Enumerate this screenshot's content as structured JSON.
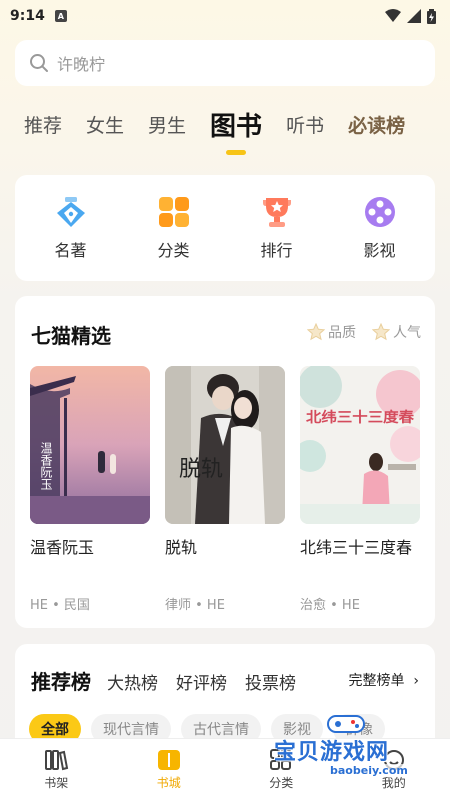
{
  "status": {
    "time": "9:14",
    "notif": "A"
  },
  "search": {
    "placeholder": "许晚柠"
  },
  "tabs": [
    "推荐",
    "女生",
    "男生",
    "图书",
    "听书",
    "必读榜"
  ],
  "shortcuts": [
    {
      "label": "名著",
      "icon": "pen-nib-icon"
    },
    {
      "label": "分类",
      "icon": "grid-icon"
    },
    {
      "label": "排行",
      "icon": "trophy-icon"
    },
    {
      "label": "影视",
      "icon": "film-reel-icon"
    }
  ],
  "picks": {
    "title": "七猫精选",
    "filters": [
      "品质",
      "人气"
    ],
    "books": [
      {
        "title": "温香阮玉",
        "tags": "HE • 民国",
        "cover_text": "温香阮玉"
      },
      {
        "title": "脱轨",
        "tags": "律师 • HE",
        "cover_text": "脱轨"
      },
      {
        "title": "北纬三十三度春",
        "tags": "治愈 • HE",
        "cover_text": "北纬三十三度春"
      }
    ]
  },
  "rank": {
    "title": "推荐榜",
    "tabs": [
      "大热榜",
      "好评榜",
      "投票榜"
    ],
    "more": "完整榜单",
    "chips": [
      "全部",
      "现代言情",
      "古代言情",
      "影视",
      "群像"
    ]
  },
  "nav": [
    {
      "label": "书架",
      "icon": "bookshelf-icon"
    },
    {
      "label": "书城",
      "icon": "book-open-icon"
    },
    {
      "label": "分类",
      "icon": "category-icon"
    },
    {
      "label": "我的",
      "icon": "profile-icon"
    }
  ],
  "watermark": {
    "text": "宝贝游戏网",
    "url": "baobeiy.com"
  },
  "colors": {
    "accent": "#f7c417",
    "chip_active": "#fbc916",
    "nav_active": "#f0a800"
  }
}
